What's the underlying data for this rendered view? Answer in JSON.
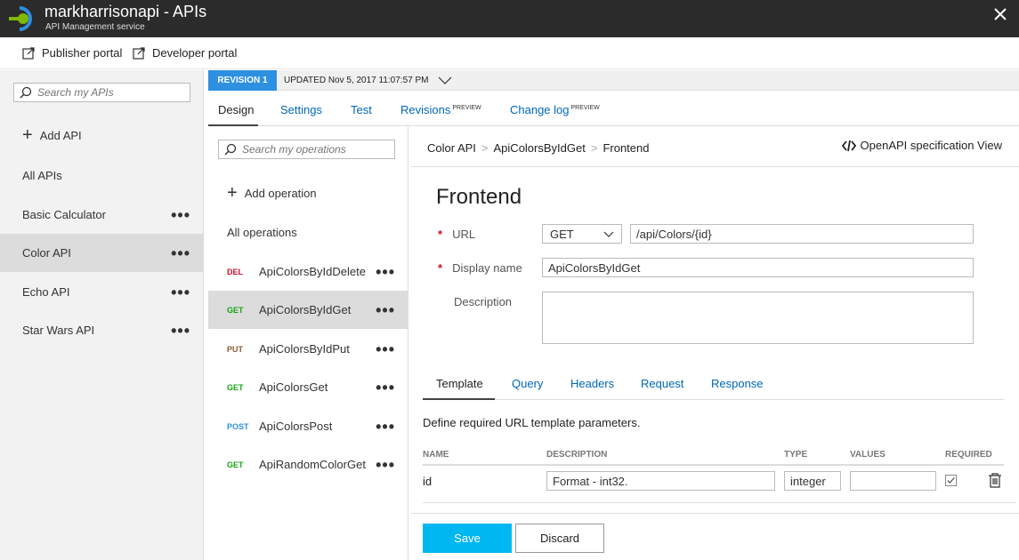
{
  "window": {
    "title": "markharrisonapi - APIs",
    "subtitle": "API Management service"
  },
  "commands": {
    "publisher_portal": "Publisher portal",
    "developer_portal": "Developer portal"
  },
  "api_list": {
    "search_placeholder": "Search my APIs",
    "add_label": "Add API",
    "items": [
      {
        "label": "All APIs",
        "has_menu": false
      },
      {
        "label": "Basic Calculator",
        "has_menu": true
      },
      {
        "label": "Color API",
        "has_menu": true,
        "selected": true
      },
      {
        "label": "Echo API",
        "has_menu": true
      },
      {
        "label": "Star Wars API",
        "has_menu": true
      }
    ],
    "menu_glyph": "•••"
  },
  "revision": {
    "badge": "REVISION 1",
    "updated": "UPDATED Nov 5, 2017 11:07:57 PM"
  },
  "tabs": [
    {
      "label": "Design",
      "sup": ""
    },
    {
      "label": "Settings",
      "sup": ""
    },
    {
      "label": "Test",
      "sup": ""
    },
    {
      "label": "Revisions",
      "sup": "PREVIEW"
    },
    {
      "label": "Change log",
      "sup": "PREVIEW"
    }
  ],
  "operations": {
    "search_placeholder": "Search my operations",
    "add_label": "Add operation",
    "all_label": "All operations",
    "items": [
      {
        "verb": "DEL",
        "name": "ApiColorsByIdDelete"
      },
      {
        "verb": "GET",
        "name": "ApiColorsByIdGet",
        "selected": true
      },
      {
        "verb": "PUT",
        "name": "ApiColorsByIdPut"
      },
      {
        "verb": "GET",
        "name": "ApiColorsGet"
      },
      {
        "verb": "POST",
        "name": "ApiColorsPost"
      },
      {
        "verb": "GET",
        "name": "ApiRandomColorGet"
      }
    ]
  },
  "main": {
    "breadcrumb": [
      "Color API",
      "ApiColorsByIdGet",
      "Frontend"
    ],
    "breadcrumb_sep": ">",
    "openapi_label": "OpenAPI specification View",
    "heading": "Frontend",
    "url_label": "URL",
    "method": "GET",
    "url_value": "/api/Colors/{id}",
    "display_name_label": "Display name",
    "display_name_value": "ApiColorsByIdGet",
    "description_label": "Description",
    "required_mark": "*",
    "subtabs": [
      "Template",
      "Query",
      "Headers",
      "Request",
      "Response"
    ],
    "template_desc": "Define required URL template parameters.",
    "columns": [
      "NAME",
      "DESCRIPTION",
      "TYPE",
      "VALUES",
      "REQUIRED"
    ],
    "param": {
      "name": "id",
      "description": "Format - int32.",
      "type": "integer",
      "values": "",
      "required": true
    },
    "save_label": "Save",
    "discard_label": "Discard"
  },
  "colors": {
    "titlebar_bg": "#2b2b2b",
    "accent_blue": "#2e90e0",
    "save_bg": "#00b7f1",
    "link": "#0067b8",
    "del": "#c8102e",
    "get": "#17a317",
    "put": "#8b5a2b"
  }
}
